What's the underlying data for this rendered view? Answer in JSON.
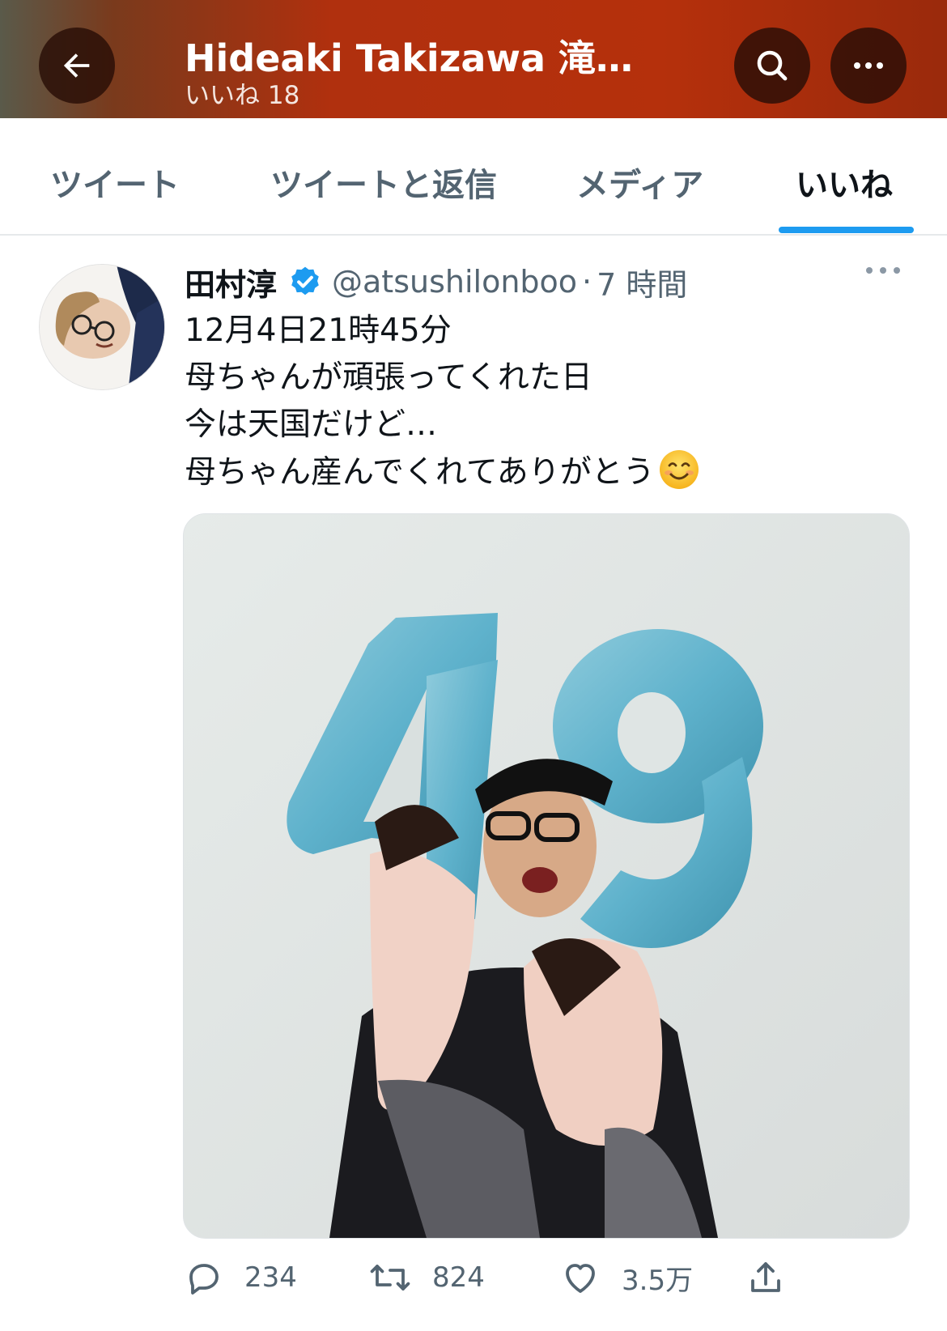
{
  "header": {
    "title": "Hideaki Takizawa 滝…",
    "subtitle": "いいね 18",
    "back_icon": "arrow-left-icon",
    "search_icon": "search-icon",
    "more_icon": "more-horizontal-icon"
  },
  "tabs": [
    {
      "label": "ツイート",
      "active": false
    },
    {
      "label": "ツイートと返信",
      "active": false
    },
    {
      "label": "メディア",
      "active": false
    },
    {
      "label": "いいね",
      "active": true
    }
  ],
  "tweet": {
    "author_name": "田村淳",
    "verified": true,
    "handle": "@atsushilonboo",
    "separator": "·",
    "time": "7 時間",
    "lines": [
      "12月4日21時45分",
      "母ちゃんが頑張ってくれた日",
      "今は天国だけど…",
      "母ちゃん産んでくれてありがとう"
    ],
    "emoji": "smiling-face-emoji",
    "media_alt": "49 balloon photo",
    "stats": {
      "replies": "234",
      "retweets": "824",
      "likes": "3.5万"
    }
  },
  "colors": {
    "header_bg": "#b5300c",
    "accent": "#1d9bf0",
    "secondary_text": "#536471",
    "primary_text": "#0f1419"
  }
}
